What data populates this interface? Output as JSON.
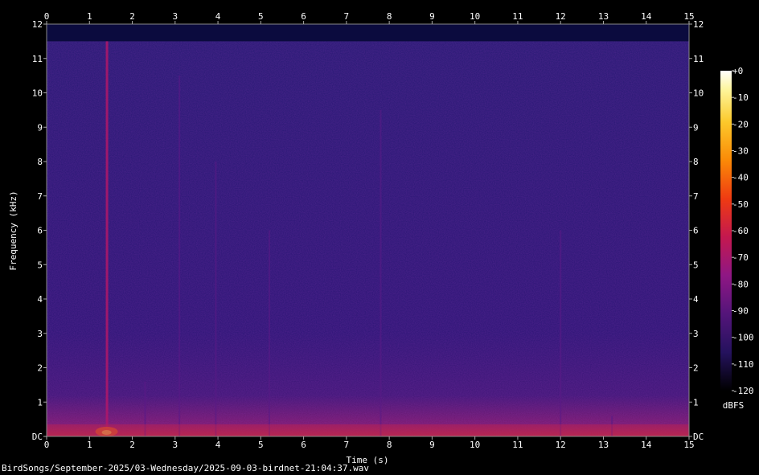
{
  "chart_data": {
    "type": "heatmap",
    "title": "",
    "xlabel": "Time (s)",
    "ylabel": "Frequency (kHz)",
    "xlim": [
      0,
      15
    ],
    "ylim": [
      0,
      12
    ],
    "x_ticks": [
      0,
      1,
      2,
      3,
      4,
      5,
      6,
      7,
      8,
      9,
      10,
      11,
      12,
      13,
      14,
      15
    ],
    "y_ticks": [
      {
        "value": 0,
        "label": "DC"
      },
      {
        "value": 1,
        "label": "1"
      },
      {
        "value": 2,
        "label": "2"
      },
      {
        "value": 3,
        "label": "3"
      },
      {
        "value": 4,
        "label": "4"
      },
      {
        "value": 5,
        "label": "5"
      },
      {
        "value": 6,
        "label": "6"
      },
      {
        "value": 7,
        "label": "7"
      },
      {
        "value": 8,
        "label": "8"
      },
      {
        "value": 9,
        "label": "9"
      },
      {
        "value": 10,
        "label": "10"
      },
      {
        "value": 11,
        "label": "11"
      },
      {
        "value": 12,
        "label": "12"
      }
    ],
    "cutoff_khz": 11.5,
    "colorbar": {
      "unit": "dBFS",
      "range": [
        -120,
        0
      ],
      "ticks": [
        "+0",
        "-10",
        "-20",
        "-30",
        "-40",
        "-50",
        "-60",
        "-70",
        "-80",
        "-90",
        "-100",
        "-110",
        "-120"
      ],
      "colors": [
        "#000000",
        "#1c0f5e",
        "#3a1470",
        "#6a1680",
        "#a3168a",
        "#d3194f",
        "#ef3b12",
        "#fb8a07",
        "#fcc92b",
        "#fdf59a",
        "#ffffff"
      ]
    },
    "events": [
      {
        "time": 1.4,
        "f_top_khz": 11.5,
        "intensity": 1.0
      },
      {
        "time": 2.3,
        "f_top_khz": 1.6,
        "intensity": 0.45
      },
      {
        "time": 3.1,
        "f_top_khz": 10.5,
        "intensity": 0.35
      },
      {
        "time": 3.95,
        "f_top_khz": 8.0,
        "intensity": 0.3
      },
      {
        "time": 5.2,
        "f_top_khz": 6.0,
        "intensity": 0.3
      },
      {
        "time": 7.8,
        "f_top_khz": 9.5,
        "intensity": 0.3
      },
      {
        "time": 12.0,
        "f_top_khz": 6.0,
        "intensity": 0.35
      },
      {
        "time": 13.2,
        "f_top_khz": 0.6,
        "intensity": 0.4
      }
    ]
  },
  "caption": "BirdSongs/September-2025/03-Wednesday/2025-09-03-birdnet-21:04:37.wav"
}
